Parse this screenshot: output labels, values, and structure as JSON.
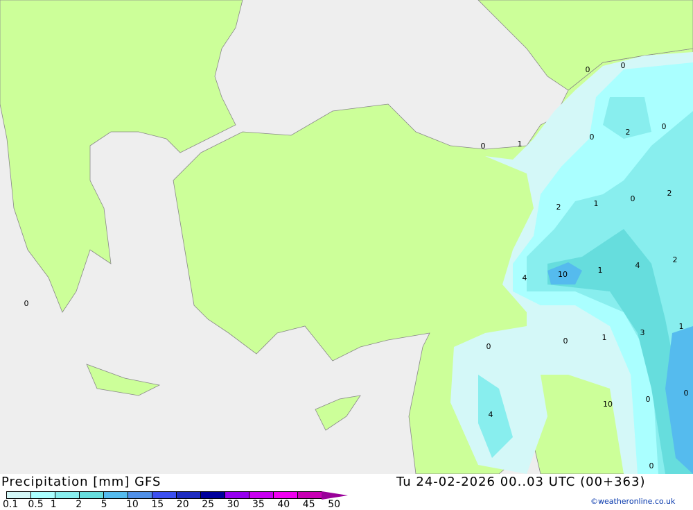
{
  "title": "Precipitation [mm] GFS",
  "valid_time": "Tu 24-02-2026 00..03 UTC (00+363)",
  "credit": "©weatheronline.co.uk",
  "legend": {
    "ticks": [
      "0.1",
      "0.5",
      "1",
      "2",
      "5",
      "10",
      "15",
      "20",
      "25",
      "30",
      "35",
      "40",
      "45",
      "50"
    ],
    "colors": [
      "#d4f8f8",
      "#aaffff",
      "#88eeee",
      "#66dddd",
      "#55bbee",
      "#5090e8",
      "#3c50f0",
      "#1e2cc0",
      "#00009c",
      "#9600f0",
      "#c800f0",
      "#f000f0",
      "#c800b4",
      "#990099"
    ]
  },
  "map_colors": {
    "land": "#ccff99",
    "sea": "#eeeeee",
    "border": "#888888"
  },
  "contour_labels": [
    {
      "t": "0"
    },
    {
      "t": "0"
    },
    {
      "t": "2"
    },
    {
      "t": "0"
    },
    {
      "t": "0"
    },
    {
      "t": "1"
    },
    {
      "t": "0"
    },
    {
      "t": "2"
    },
    {
      "t": "1"
    },
    {
      "t": "0"
    },
    {
      "t": "2"
    },
    {
      "t": "4"
    },
    {
      "t": "10"
    },
    {
      "t": "1"
    },
    {
      "t": "4"
    },
    {
      "t": "2"
    },
    {
      "t": "0"
    },
    {
      "t": "0"
    },
    {
      "t": "0"
    },
    {
      "t": "1"
    },
    {
      "t": "3"
    },
    {
      "t": "1"
    },
    {
      "t": "4"
    },
    {
      "t": "0"
    },
    {
      "t": "10"
    },
    {
      "t": "0"
    },
    {
      "t": "0"
    }
  ]
}
